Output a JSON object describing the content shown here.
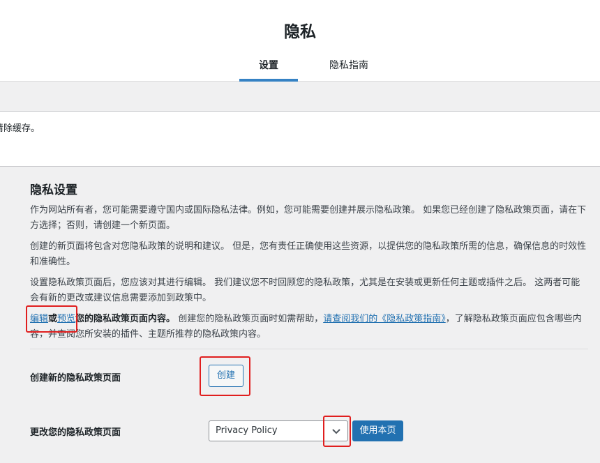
{
  "header": {
    "title": "隐私",
    "tabs": [
      {
        "label": "设置",
        "active": true
      },
      {
        "label": "隐私指南",
        "active": false
      }
    ]
  },
  "notice": {
    "text": "清除缓存。"
  },
  "section": {
    "title": "隐私设置",
    "paragraphs": {
      "p1": "作为网站所有者，您可能需要遵守国内或国际隐私法律。例如，您可能需要创建并展示隐私政策。 如果您已经创建了隐私政策页面，请在下方选择；否则，请创建一个新页面。",
      "p2": "创建的新页面将包含对您隐私政策的说明和建议。 但是，您有责任正确使用这些资源，以提供您的隐私政策所需的信息，确保信息的时效性和准确性。",
      "p3": "设置隐私政策页面后，您应该对其进行编辑。 我们建议您不时回顾您的隐私政策，尤其是在安装或更新任何主题或插件之后。 这两者可能会有新的更改或建议信息需要添加到政策中。"
    },
    "p4": {
      "edit_link": "编辑",
      "or": "或",
      "preview_link": "预览",
      "bold_text": "您的隐私政策页面内容。",
      "text_before_link": " 创建您的隐私政策页面时如需帮助，",
      "guide_link": "请查阅我们的《隐私政策指南》",
      "text_after_link": "，了解隐私政策页面应包含哪些内容，并查阅您所安装的插件、主题所推荐的隐私政策内容。"
    }
  },
  "create_row": {
    "label": "创建新的隐私政策页面",
    "button": "创建"
  },
  "change_row": {
    "label": "更改您的隐私政策页面",
    "selected": "Privacy Policy",
    "button": "使用本页"
  },
  "colors": {
    "accent": "#2271b1",
    "highlight": "#e01e1e"
  }
}
